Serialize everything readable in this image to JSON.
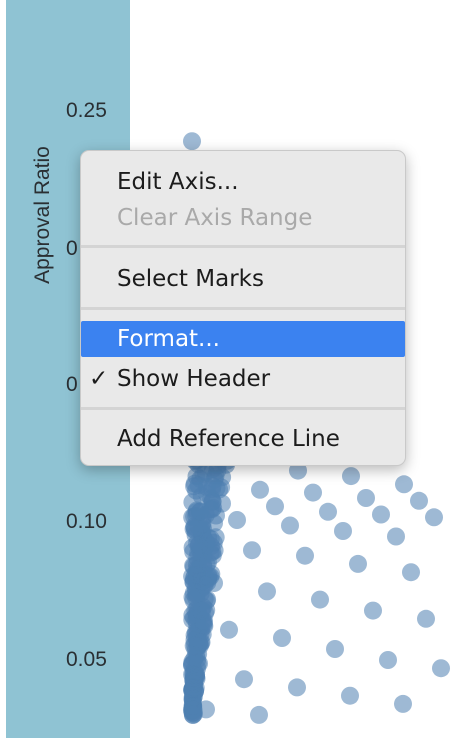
{
  "axis": {
    "title": "Approval Ratio",
    "ticks": [
      "0.25",
      "0.20",
      "0.15",
      "0.10",
      "0.05"
    ],
    "partial_tick_labels": [
      "0",
      "0"
    ]
  },
  "context_menu": {
    "items": [
      {
        "label": "Edit Axis...",
        "enabled": true,
        "checked": false,
        "highlighted": false
      },
      {
        "label": "Clear Axis Range",
        "enabled": false,
        "checked": false,
        "highlighted": false
      },
      {
        "label": "Select Marks",
        "enabled": true,
        "checked": false,
        "highlighted": false
      },
      {
        "label": "Format...",
        "enabled": true,
        "checked": false,
        "highlighted": true
      },
      {
        "label": "Show Header",
        "enabled": true,
        "checked": true,
        "highlighted": false
      },
      {
        "label": "Add Reference Line",
        "enabled": true,
        "checked": false,
        "highlighted": false
      }
    ],
    "check_mark": "✓"
  },
  "colors": {
    "axis_pane": "#8fc3d3",
    "marks": "#4f7fb0",
    "menu_bg": "#e9e9e9",
    "highlight": "#3b82f0"
  },
  "chart_data": {
    "type": "scatter",
    "ylabel": "Approval Ratio",
    "y_ticks": [
      0.25,
      0.2,
      0.15,
      0.1,
      0.05
    ],
    "ylim": [
      0.025,
      0.27
    ],
    "points_y": [
      0.239,
      0.141,
      0.119,
      0.117,
      0.114,
      0.113,
      0.112,
      0.111,
      0.109,
      0.108,
      0.107,
      0.106,
      0.104,
      0.103,
      0.102,
      0.101,
      0.099,
      0.097,
      0.095,
      0.092,
      0.09,
      0.088,
      0.085,
      0.082,
      0.078,
      0.075,
      0.072,
      0.068,
      0.065,
      0.061,
      0.058,
      0.054,
      0.05,
      0.047,
      0.043,
      0.04,
      0.037,
      0.034,
      0.032,
      0.03
    ]
  }
}
